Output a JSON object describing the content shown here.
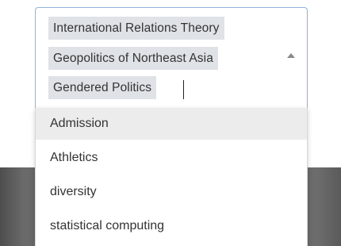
{
  "select": {
    "selected_items": [
      "International Relations Theory",
      "Geopolitics of Northeast Asia",
      "Gendered Politics"
    ],
    "toggle_icon": "chevron-up-icon"
  },
  "dropdown": {
    "options": [
      "Admission",
      "Athletics",
      "diversity",
      "statistical computing"
    ],
    "highlighted_option": "Admission"
  },
  "colors": {
    "border_focus": "#8fb2dd",
    "chip_background": "#dfe2e6",
    "option_highlight": "#ececec",
    "backdrop": "#5f5f5f"
  }
}
